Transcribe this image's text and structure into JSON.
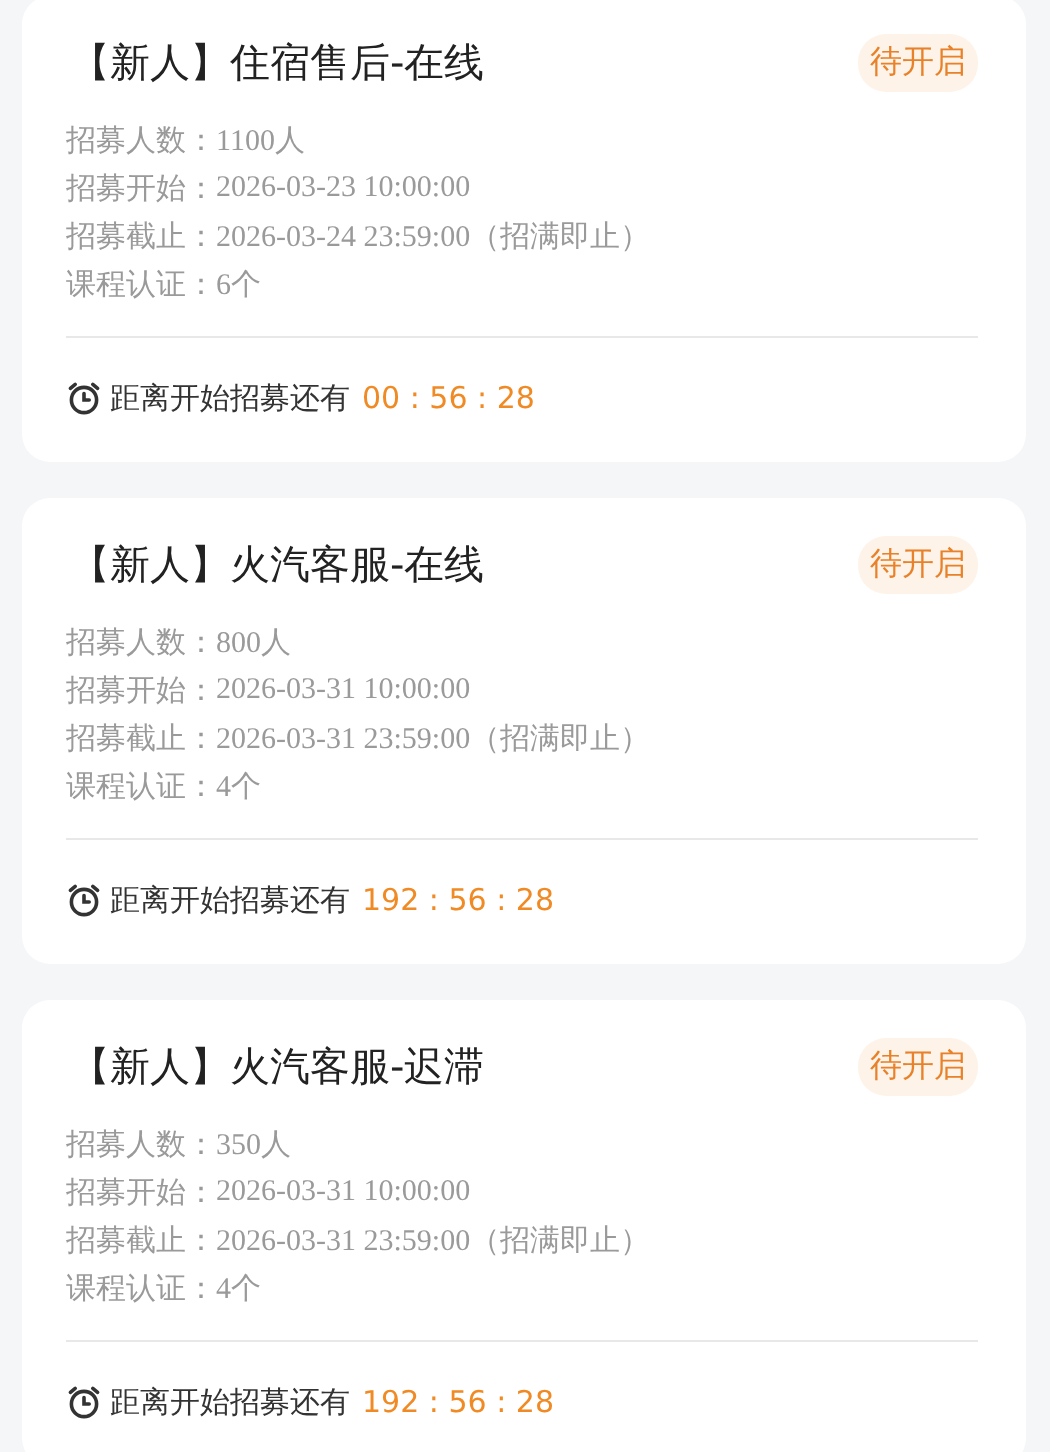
{
  "cards": [
    {
      "title": "【新人】住宿售后-在线",
      "status": "待开启",
      "fields": [
        {
          "label": "招募人数：",
          "value": "1100人"
        },
        {
          "label": "招募开始：",
          "value": "2026-03-23 10:00:00"
        },
        {
          "label": "招募截止：",
          "value": "2026-03-24 23:59:00（招满即止）"
        },
        {
          "label": "课程认证：",
          "value": "6个"
        }
      ],
      "countdown_label": "距离开始招募还有",
      "countdown": "00 : 56 : 28"
    },
    {
      "title": "【新人】火汽客服-在线",
      "status": "待开启",
      "fields": [
        {
          "label": "招募人数：",
          "value": "800人"
        },
        {
          "label": "招募开始：",
          "value": "2026-03-31 10:00:00"
        },
        {
          "label": "招募截止：",
          "value": "2026-03-31 23:59:00（招满即止）"
        },
        {
          "label": "课程认证：",
          "value": "4个"
        }
      ],
      "countdown_label": "距离开始招募还有",
      "countdown": "192 : 56 : 28"
    },
    {
      "title": "【新人】火汽客服-迟滞",
      "status": "待开启",
      "fields": [
        {
          "label": "招募人数：",
          "value": "350人"
        },
        {
          "label": "招募开始：",
          "value": "2026-03-31 10:00:00"
        },
        {
          "label": "招募截止：",
          "value": "2026-03-31 23:59:00（招满即止）"
        },
        {
          "label": "课程认证：",
          "value": "4个"
        }
      ],
      "countdown_label": "距离开始招募还有",
      "countdown": "192 : 56 : 28"
    }
  ]
}
